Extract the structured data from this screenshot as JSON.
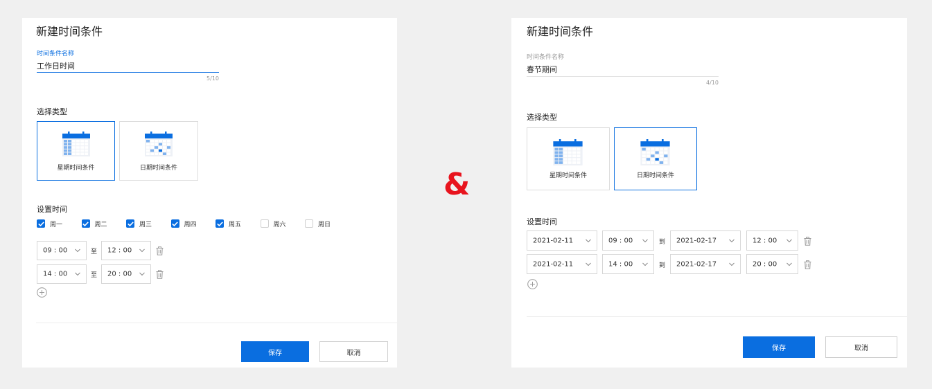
{
  "panel_left": {
    "title": "新建时间条件",
    "name_field": {
      "label": "时间条件名称",
      "value": "工作日时间",
      "counter": "5/10"
    },
    "type_section": {
      "label": "选择类型",
      "cards": [
        {
          "label": "星期时间条件",
          "icon": "calendar-week-icon",
          "selected": true
        },
        {
          "label": "日期时间条件",
          "icon": "calendar-date-icon",
          "selected": false
        }
      ]
    },
    "time_section": {
      "label": "设置时间",
      "weekdays": [
        {
          "label": "周一",
          "checked": true
        },
        {
          "label": "周二",
          "checked": true
        },
        {
          "label": "周三",
          "checked": true
        },
        {
          "label": "周四",
          "checked": true
        },
        {
          "label": "周五",
          "checked": true
        },
        {
          "label": "周六",
          "checked": false
        },
        {
          "label": "周日",
          "checked": false
        }
      ],
      "separator": "至",
      "ranges": [
        {
          "start": "09 : 00",
          "end": "12 : 00"
        },
        {
          "start": "14 : 00",
          "end": "20 : 00"
        }
      ]
    },
    "buttons": {
      "save": "保存",
      "cancel": "取消"
    }
  },
  "ampersand": "&",
  "panel_right": {
    "title": "新建时间条件",
    "name_field": {
      "label": "时间条件名称",
      "value": "春节期间",
      "counter": "4/10"
    },
    "type_section": {
      "label": "选择类型",
      "cards": [
        {
          "label": "星期时间条件",
          "icon": "calendar-week-icon",
          "selected": false
        },
        {
          "label": "日期时间条件",
          "icon": "calendar-date-icon",
          "selected": true
        }
      ]
    },
    "time_section": {
      "label": "设置时间",
      "separator": "到",
      "ranges": [
        {
          "start_date": "2021-02-11",
          "start_time": "09 : 00",
          "end_date": "2021-02-17",
          "end_time": "12 : 00"
        },
        {
          "start_date": "2021-02-11",
          "start_time": "14 : 00",
          "end_date": "2021-02-17",
          "end_time": "20 : 00"
        }
      ]
    },
    "buttons": {
      "save": "保存",
      "cancel": "取消"
    }
  },
  "colors": {
    "accent": "#0a6ee0",
    "ampersand": "#e8141e",
    "background": "#f0f0f0"
  }
}
